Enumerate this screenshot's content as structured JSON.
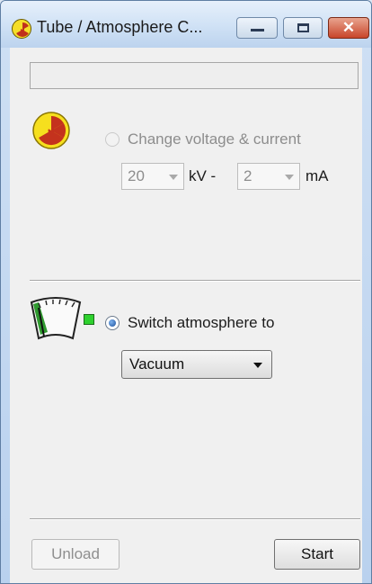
{
  "window": {
    "title": "Tube / Atmosphere C...",
    "controls": {
      "minimize": "minimize-icon",
      "maximize": "maximize-icon",
      "close": "close-icon"
    }
  },
  "status_field": {
    "value": ""
  },
  "tube": {
    "radio_label": "Change voltage & current",
    "radio_checked": false,
    "radio_enabled": false,
    "voltage": {
      "value": "20",
      "unit": "kV -"
    },
    "current": {
      "value": "2",
      "unit": "mA"
    }
  },
  "atmosphere": {
    "radio_label": "Switch atmosphere to",
    "radio_checked": true,
    "indicator_color": "#2ed12e",
    "selected": "Vacuum"
  },
  "buttons": {
    "unload": "Unload",
    "start": "Start"
  },
  "icons": {
    "title": "radiation-icon",
    "tube": "radiation-icon",
    "atmosphere": "gauge-icon"
  }
}
